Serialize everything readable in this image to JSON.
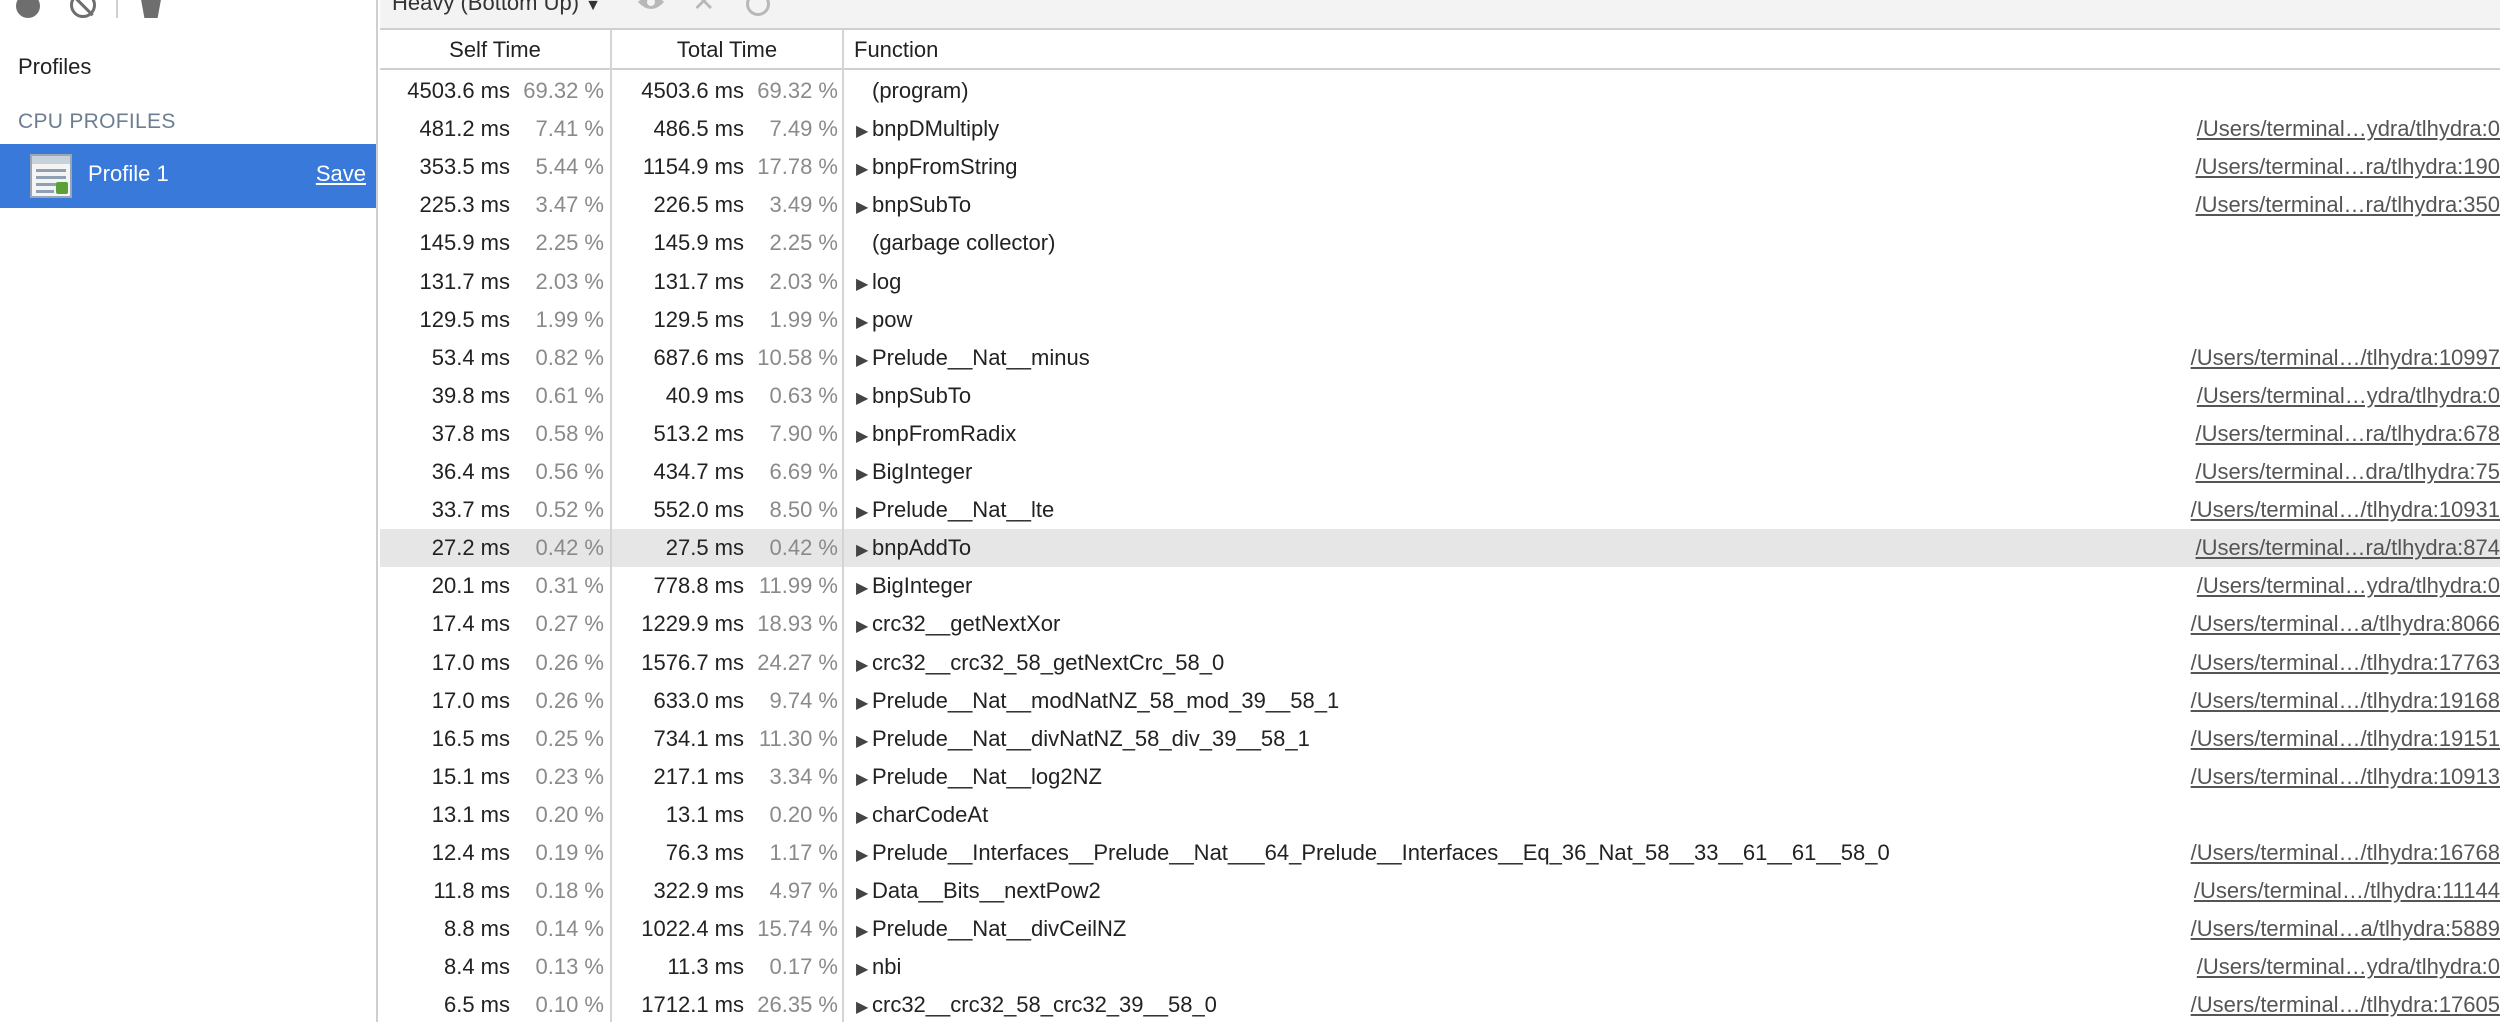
{
  "sidebar": {
    "profiles_title": "Profiles",
    "cpu_profiles_title": "CPU PROFILES",
    "profile_label": "Profile 1",
    "save_label": "Save"
  },
  "toolbar": {
    "view_label": "Heavy (Bottom Up)"
  },
  "grid": {
    "columns": {
      "self": "Self Time",
      "total": "Total Time",
      "function": "Function"
    },
    "rows": [
      {
        "self_ms": "4503.6 ms",
        "self_pct": "69.32 %",
        "total_ms": "4503.6 ms",
        "total_pct": "69.32 %",
        "func": "(program)",
        "url": "",
        "expandable": false
      },
      {
        "self_ms": "481.2 ms",
        "self_pct": "7.41 %",
        "total_ms": "486.5 ms",
        "total_pct": "7.49 %",
        "func": "bnpDMultiply",
        "url": "/Users/terminal…ydra/tlhydra:0",
        "expandable": true
      },
      {
        "self_ms": "353.5 ms",
        "self_pct": "5.44 %",
        "total_ms": "1154.9 ms",
        "total_pct": "17.78 %",
        "func": "bnpFromString",
        "url": "/Users/terminal…ra/tlhydra:190",
        "expandable": true
      },
      {
        "self_ms": "225.3 ms",
        "self_pct": "3.47 %",
        "total_ms": "226.5 ms",
        "total_pct": "3.49 %",
        "func": "bnpSubTo",
        "url": "/Users/terminal…ra/tlhydra:350",
        "expandable": true
      },
      {
        "self_ms": "145.9 ms",
        "self_pct": "2.25 %",
        "total_ms": "145.9 ms",
        "total_pct": "2.25 %",
        "func": "(garbage collector)",
        "url": "",
        "expandable": false
      },
      {
        "self_ms": "131.7 ms",
        "self_pct": "2.03 %",
        "total_ms": "131.7 ms",
        "total_pct": "2.03 %",
        "func": "log",
        "url": "",
        "expandable": true
      },
      {
        "self_ms": "129.5 ms",
        "self_pct": "1.99 %",
        "total_ms": "129.5 ms",
        "total_pct": "1.99 %",
        "func": "pow",
        "url": "",
        "expandable": true
      },
      {
        "self_ms": "53.4 ms",
        "self_pct": "0.82 %",
        "total_ms": "687.6 ms",
        "total_pct": "10.58 %",
        "func": "Prelude__Nat__minus",
        "url": "/Users/terminal…/tlhydra:10997",
        "expandable": true
      },
      {
        "self_ms": "39.8 ms",
        "self_pct": "0.61 %",
        "total_ms": "40.9 ms",
        "total_pct": "0.63 %",
        "func": "bnpSubTo",
        "url": "/Users/terminal…ydra/tlhydra:0",
        "expandable": true
      },
      {
        "self_ms": "37.8 ms",
        "self_pct": "0.58 %",
        "total_ms": "513.2 ms",
        "total_pct": "7.90 %",
        "func": "bnpFromRadix",
        "url": "/Users/terminal…ra/tlhydra:678",
        "expandable": true
      },
      {
        "self_ms": "36.4 ms",
        "self_pct": "0.56 %",
        "total_ms": "434.7 ms",
        "total_pct": "6.69 %",
        "func": "BigInteger",
        "url": "/Users/terminal…dra/tlhydra:75",
        "expandable": true
      },
      {
        "self_ms": "33.7 ms",
        "self_pct": "0.52 %",
        "total_ms": "552.0 ms",
        "total_pct": "8.50 %",
        "func": "Prelude__Nat__lte",
        "url": "/Users/terminal…/tlhydra:10931",
        "expandable": true
      },
      {
        "self_ms": "27.2 ms",
        "self_pct": "0.42 %",
        "total_ms": "27.5 ms",
        "total_pct": "0.42 %",
        "func": "bnpAddTo",
        "url": "/Users/terminal…ra/tlhydra:874",
        "expandable": true,
        "selected": true
      },
      {
        "self_ms": "20.1 ms",
        "self_pct": "0.31 %",
        "total_ms": "778.8 ms",
        "total_pct": "11.99 %",
        "func": "BigInteger",
        "url": "/Users/terminal…ydra/tlhydra:0",
        "expandable": true
      },
      {
        "self_ms": "17.4 ms",
        "self_pct": "0.27 %",
        "total_ms": "1229.9 ms",
        "total_pct": "18.93 %",
        "func": "crc32__getNextXor",
        "url": "/Users/terminal…a/tlhydra:8066",
        "expandable": true
      },
      {
        "self_ms": "17.0 ms",
        "self_pct": "0.26 %",
        "total_ms": "1576.7 ms",
        "total_pct": "24.27 %",
        "func": "crc32__crc32_58_getNextCrc_58_0",
        "url": "/Users/terminal…/tlhydra:17763",
        "expandable": true
      },
      {
        "self_ms": "17.0 ms",
        "self_pct": "0.26 %",
        "total_ms": "633.0 ms",
        "total_pct": "9.74 %",
        "func": "Prelude__Nat__modNatNZ_58_mod_39__58_1",
        "url": "/Users/terminal…/tlhydra:19168",
        "expandable": true
      },
      {
        "self_ms": "16.5 ms",
        "self_pct": "0.25 %",
        "total_ms": "734.1 ms",
        "total_pct": "11.30 %",
        "func": "Prelude__Nat__divNatNZ_58_div_39__58_1",
        "url": "/Users/terminal…/tlhydra:19151",
        "expandable": true
      },
      {
        "self_ms": "15.1 ms",
        "self_pct": "0.23 %",
        "total_ms": "217.1 ms",
        "total_pct": "3.34 %",
        "func": "Prelude__Nat__log2NZ",
        "url": "/Users/terminal…/tlhydra:10913",
        "expandable": true
      },
      {
        "self_ms": "13.1 ms",
        "self_pct": "0.20 %",
        "total_ms": "13.1 ms",
        "total_pct": "0.20 %",
        "func": "charCodeAt",
        "url": "",
        "expandable": true
      },
      {
        "self_ms": "12.4 ms",
        "self_pct": "0.19 %",
        "total_ms": "76.3 ms",
        "total_pct": "1.17 %",
        "func": "Prelude__Interfaces__Prelude__Nat___64_Prelude__Interfaces__Eq_36_Nat_58__33__61__61__58_0",
        "url": "/Users/terminal…/tlhydra:16768",
        "expandable": true
      },
      {
        "self_ms": "11.8 ms",
        "self_pct": "0.18 %",
        "total_ms": "322.9 ms",
        "total_pct": "4.97 %",
        "func": "Data__Bits__nextPow2",
        "url": "/Users/terminal…/tlhydra:11144",
        "expandable": true
      },
      {
        "self_ms": "8.8 ms",
        "self_pct": "0.14 %",
        "total_ms": "1022.4 ms",
        "total_pct": "15.74 %",
        "func": "Prelude__Nat__divCeilNZ",
        "url": "/Users/terminal…a/tlhydra:5889",
        "expandable": true
      },
      {
        "self_ms": "8.4 ms",
        "self_pct": "0.13 %",
        "total_ms": "11.3 ms",
        "total_pct": "0.17 %",
        "func": "nbi",
        "url": "/Users/terminal…ydra/tlhydra:0",
        "expandable": true
      },
      {
        "self_ms": "6.5 ms",
        "self_pct": "0.10 %",
        "total_ms": "1712.1 ms",
        "total_pct": "26.35 %",
        "func": "crc32__crc32_58_crc32_39__58_0",
        "url": "/Users/terminal…/tlhydra:17605",
        "expandable": true
      }
    ]
  }
}
